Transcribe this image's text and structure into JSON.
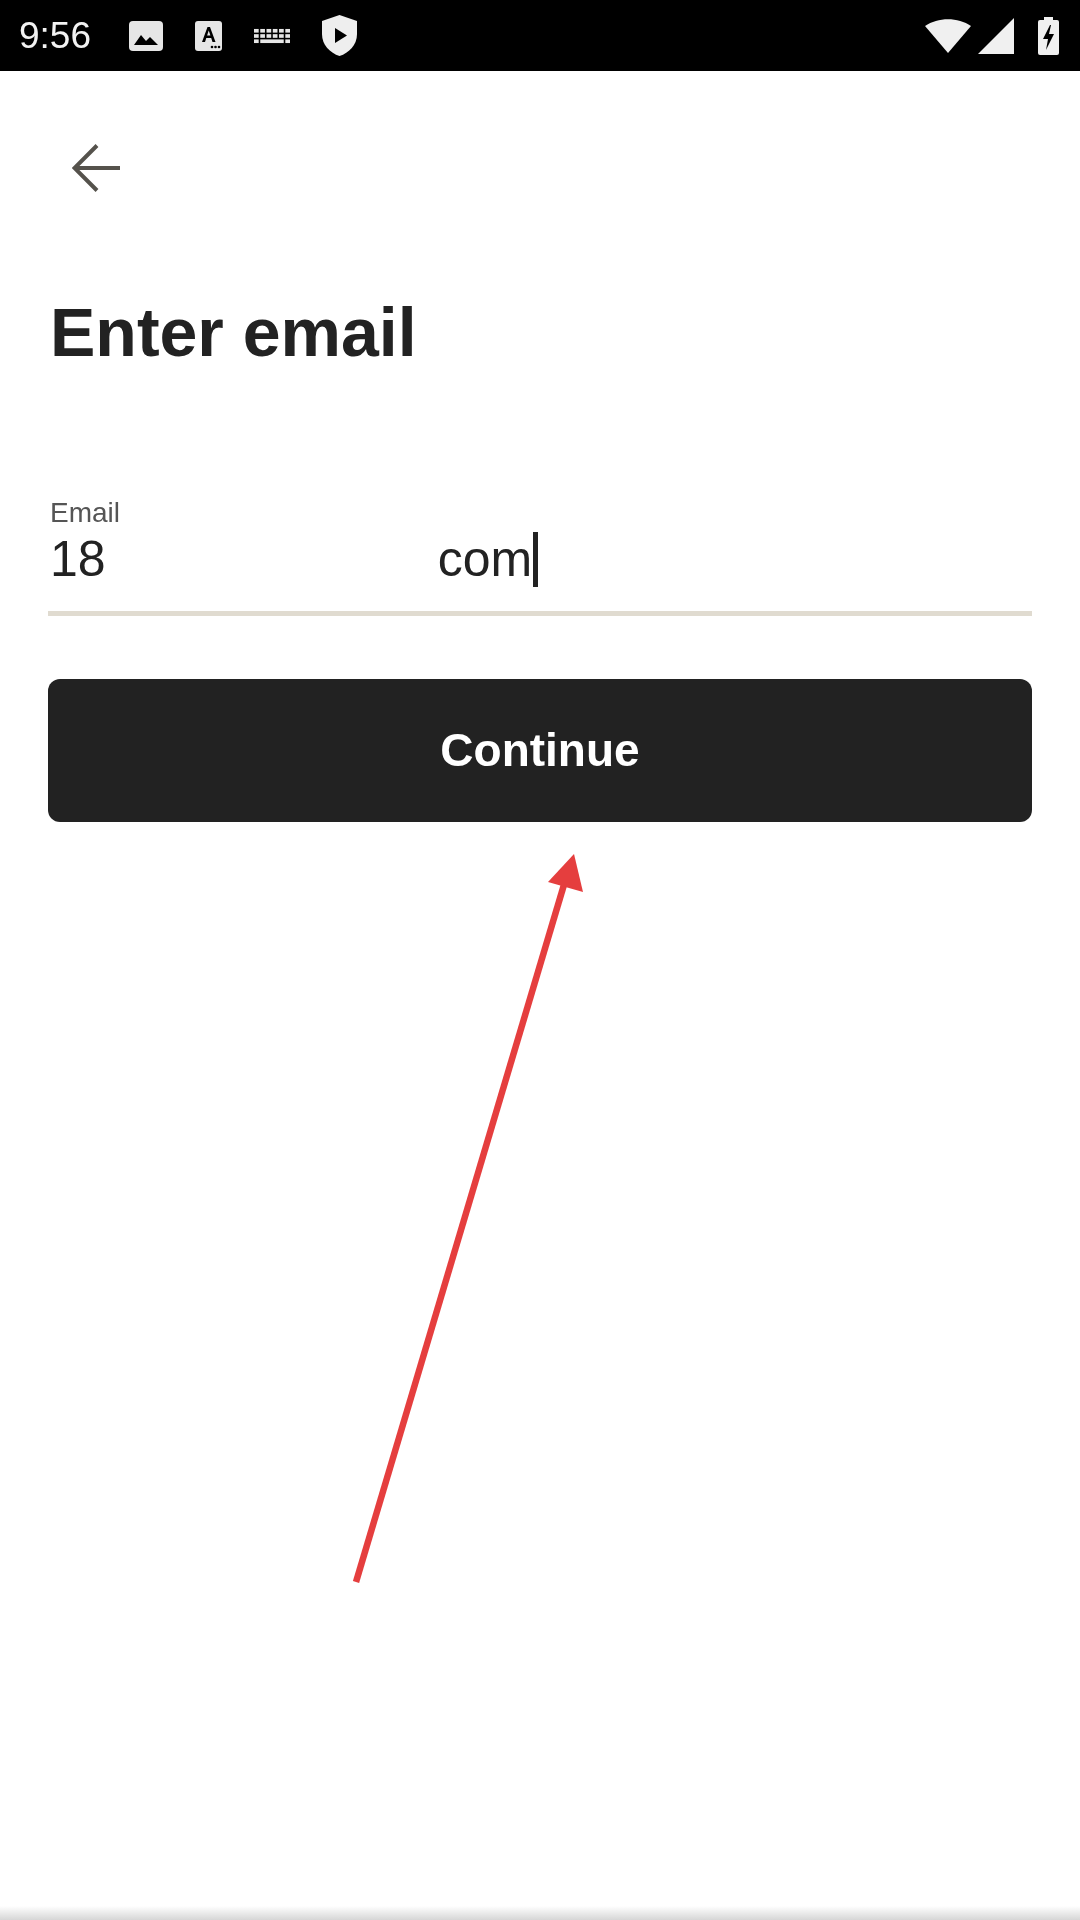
{
  "status_bar": {
    "time": "9:56"
  },
  "title": "Enter email",
  "email_field": {
    "label": "Email",
    "value_parts": [
      "18",
      "com"
    ],
    "focused": true
  },
  "continue_button": {
    "label": "Continue"
  }
}
